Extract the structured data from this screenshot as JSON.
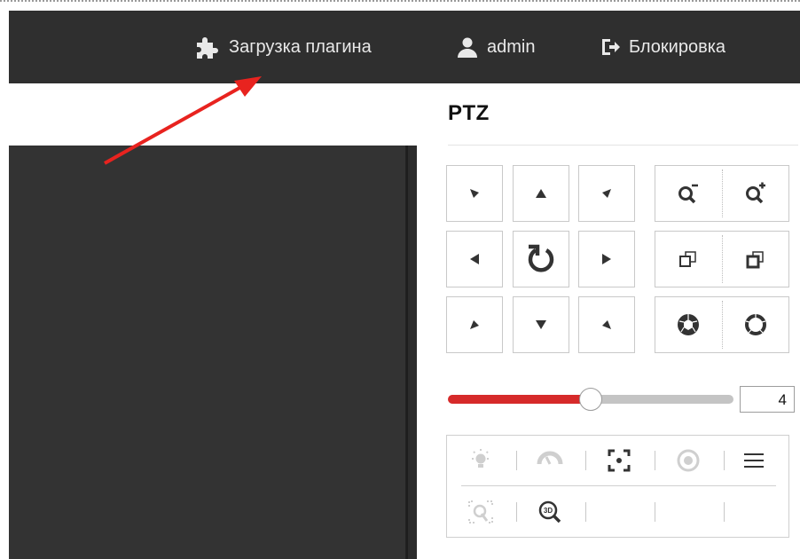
{
  "header": {
    "plugin_label": "Загрузка плагина",
    "user_label": "admin",
    "lock_label": "Блокировка",
    "icons": {
      "plugin": "puzzle-icon",
      "user": "user-icon",
      "lock": "logout-icon"
    }
  },
  "ptz": {
    "title": "PTZ",
    "speed_value": "4",
    "speed_level_fraction": 0.5,
    "direction_buttons": [
      "up-left",
      "up",
      "up-right",
      "left",
      "auto-rotate",
      "right",
      "down-left",
      "down",
      "down-right"
    ],
    "lens_buttons": [
      "zoom-out",
      "zoom-in",
      "focus-near",
      "focus-far",
      "iris-open",
      "iris-close"
    ],
    "tools_row1": [
      "light-icon",
      "wiper-icon",
      "focus-assist-icon",
      "lens-init-icon",
      "menu-icon"
    ],
    "tools_row2": [
      "manual-tracking-icon",
      "zoom-3d-icon"
    ]
  },
  "colors": {
    "header_bg": "#2f2f2f",
    "video_bg": "#333333",
    "accent_red": "#d62a2a",
    "annotation_arrow": "#e8231f"
  }
}
